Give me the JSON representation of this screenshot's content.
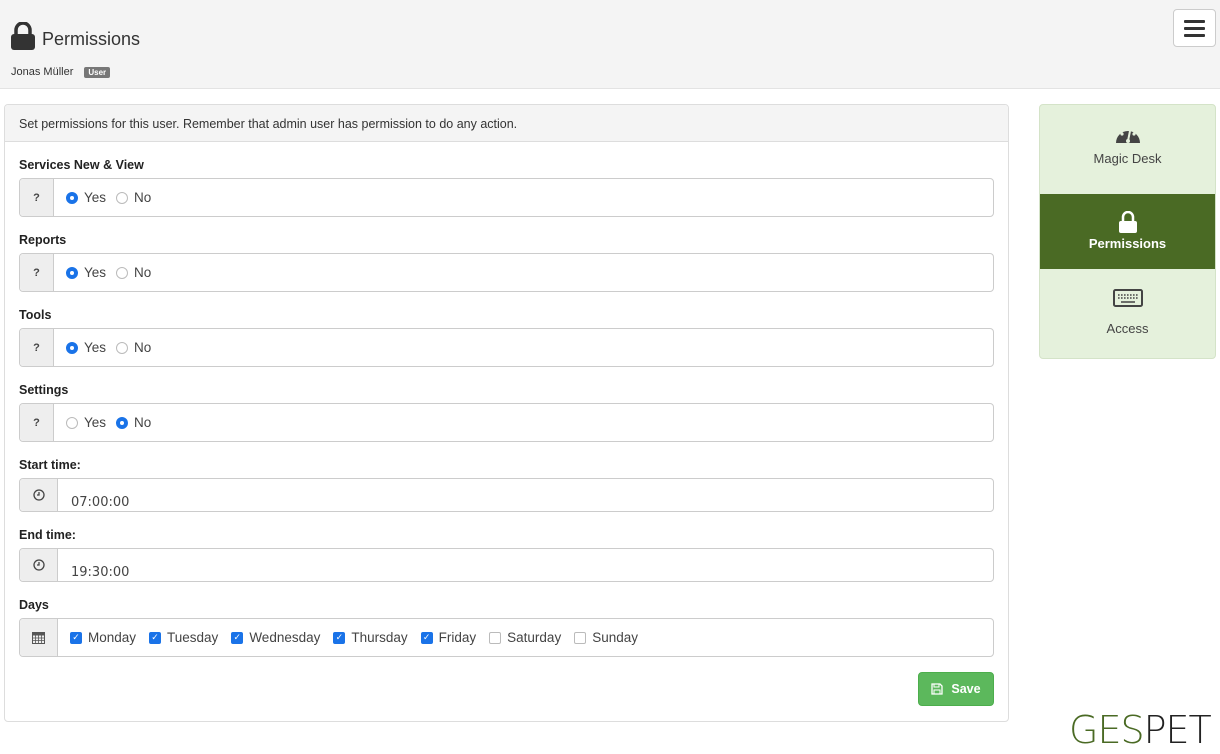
{
  "header": {
    "title": "Permissions",
    "title_icon": "lock-icon",
    "user_name": "Jonas Müller",
    "user_badge": "User",
    "menu_icon": "hamburger-menu-icon"
  },
  "panel": {
    "info": "Set permissions for this user. Remember that admin user has permission to do any action.",
    "permissions": [
      {
        "label": "Services New & View",
        "help": "?",
        "yes_label": "Yes",
        "no_label": "No",
        "value": "Yes"
      },
      {
        "label": "Reports",
        "help": "?",
        "yes_label": "Yes",
        "no_label": "No",
        "value": "Yes"
      },
      {
        "label": "Tools",
        "help": "?",
        "yes_label": "Yes",
        "no_label": "No",
        "value": "Yes"
      },
      {
        "label": "Settings",
        "help": "?",
        "yes_label": "Yes",
        "no_label": "No",
        "value": "No"
      }
    ],
    "start_time": {
      "label": "Start time:",
      "value": "07:00:00",
      "icon": "clock-icon"
    },
    "end_time": {
      "label": "End time:",
      "value": "19:30:00",
      "icon": "clock-icon"
    },
    "days": {
      "label": "Days",
      "icon": "calendar-icon",
      "items": [
        {
          "label": "Monday",
          "checked": true
        },
        {
          "label": "Tuesday",
          "checked": true
        },
        {
          "label": "Wednesday",
          "checked": true
        },
        {
          "label": "Thursday",
          "checked": true
        },
        {
          "label": "Friday",
          "checked": true
        },
        {
          "label": "Saturday",
          "checked": false
        },
        {
          "label": "Sunday",
          "checked": false
        }
      ]
    },
    "save_label": "Save"
  },
  "sidenav": {
    "items": [
      {
        "label": "Magic Desk",
        "icon": "dashboard-gauge-icon",
        "active": false
      },
      {
        "label": "Permissions",
        "icon": "lock-icon",
        "active": true
      },
      {
        "label": "Access",
        "icon": "keyboard-icon",
        "active": false
      }
    ]
  },
  "logo": {
    "part1": "GES",
    "part2": "PET"
  },
  "colors": {
    "brand_green": "#4a6a24",
    "nav_bg": "#e5f1dc",
    "save_green": "#5cb85c",
    "radio_blue": "#1a73e8"
  }
}
